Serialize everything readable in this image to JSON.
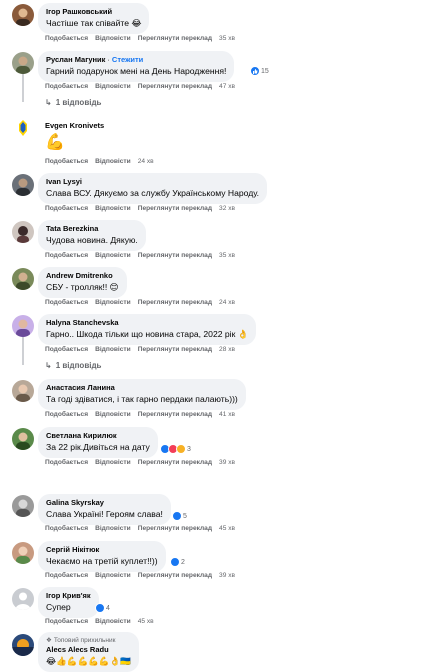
{
  "action_labels": {
    "like": "Подобається",
    "reply": "Відповісти",
    "translate": "Переглянути переклад"
  },
  "comments": [
    {
      "author": "Ігор Рашковський",
      "text": "Частіше так співайте 😂",
      "time": "35 хв",
      "reactions": "",
      "avatar_color": "#8a5a3a"
    },
    {
      "author": "Руслан Магуник",
      "follow": "Стежити",
      "text": "Гарний подарунок мені на День Народження!",
      "time": "47 хв",
      "reactions": "15",
      "replies": "1 відповідь",
      "avatar_color": "#6b6e5a"
    },
    {
      "author": "Evgen Kronivets",
      "text": "💪",
      "time": "24 хв",
      "reactions": "",
      "avatar_color": "#1f5fbf"
    },
    {
      "author": "Ivan Lysyi",
      "text": "Слава ВСУ. Дякуємо за службу Українському Народу.",
      "time": "32 хв",
      "reactions": "",
      "avatar_color": "#4a4f57"
    },
    {
      "author": "Tata Berezkina",
      "text": "Чудова новина. Дякую.",
      "time": "35 хв",
      "reactions": "",
      "avatar_color": "#3b2a2a"
    },
    {
      "author": "Andrew Dmitrenko",
      "text": "СБУ - тролляк!! 😊",
      "time": "24 хв",
      "reactions": "",
      "avatar_color": "#5d6b3f"
    },
    {
      "author": "Halyna Stanchevska",
      "text": "Гарно.. Шкода тільки що новина стара, 2022 рік 👌",
      "time": "28 хв",
      "reactions": "",
      "replies": "1 відповідь",
      "avatar_color": "#7c5fb0"
    },
    {
      "author": "Анастасия Ланина",
      "text": "Та годі здіватися, і так гарно пердаки палають)))",
      "time": "41 хв",
      "reactions": "",
      "avatar_color": "#8c7a6a"
    },
    {
      "author": "Светлана Кирилюк",
      "text": "За 22 рік.Дивіться на дату",
      "time": "39 хв",
      "reactions": "3",
      "avatar_color": "#3e6d3a"
    },
    {
      "author": "Galina Skyrskay",
      "text": "Слава Україні! Героям слава!",
      "time": "45 хв",
      "reactions": "5",
      "avatar_color": "#777777"
    },
    {
      "author": "Сергій Нікітюк",
      "text": "Чекаємо на третій куплет!!))",
      "time": "39 хв",
      "reactions": "2",
      "avatar_color": "#a0604a"
    },
    {
      "author": "Ігор Крив'як",
      "text": "Супер",
      "time": "45 хв",
      "reactions": "4",
      "avatar_color": "#c9ccd1"
    },
    {
      "author": "Alecs Alecs Radu",
      "top_label": "Топовий прихильник",
      "text": "😂👍💪💪💪💪👌🇺🇦",
      "time": "",
      "reactions": "",
      "avatar_color": "#2b4a7a"
    }
  ]
}
